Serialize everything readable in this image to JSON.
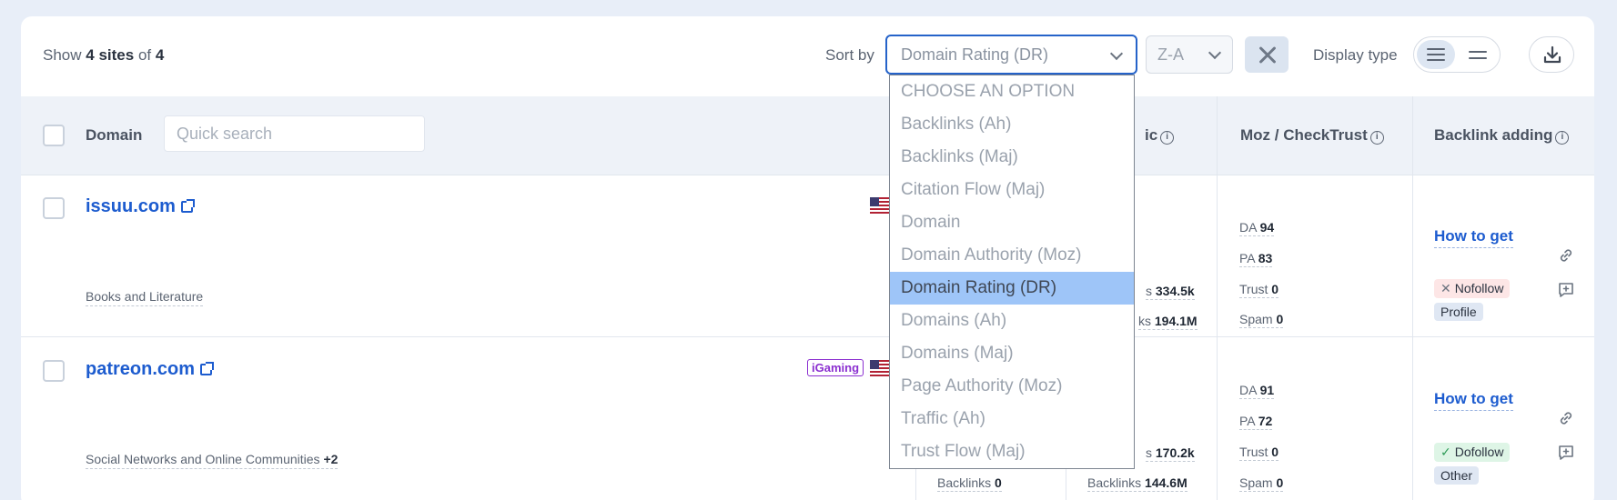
{
  "toolbar": {
    "show_prefix": "Show",
    "show_count": "4 sites",
    "show_mid": "of",
    "show_total": "4",
    "sort_by_label": "Sort by",
    "sort_value": "Domain Rating (DR)",
    "order_value": "Z-A",
    "display_type_label": "Display type"
  },
  "table": {
    "headers": {
      "domain": "Domain",
      "quick_search_placeholder": "Quick search",
      "traffic_partial": "ic",
      "moz": "Moz / CheckTrust",
      "backlink_adding": "Backlink adding",
      "info_glyph": "i"
    },
    "rows": [
      {
        "domain": "issuu.com",
        "category": "Books and Literature",
        "category_more": "",
        "badge": "",
        "traffic_label_a": "s",
        "traffic_value_a": "334.5k",
        "traffic_label_b": "ks",
        "traffic_value_b": "194.1M",
        "da_label": "DA",
        "da": "94",
        "pa_label": "PA",
        "pa": "83",
        "trust_label": "Trust",
        "trust": "0",
        "spam_label": "Spam",
        "spam": "0",
        "how_to": "How to get",
        "follow_mark": "✕",
        "follow": "Nofollow",
        "link_type": "Profile"
      },
      {
        "domain": "patreon.com",
        "category": "Social Networks and Online Communities",
        "category_more": "+2",
        "badge": "iGaming",
        "partial_backlinks_label": "Backlinks",
        "partial_backlinks_value": "0",
        "traffic_label_a": "s",
        "traffic_value_a": "170.2k",
        "traffic_label_b": "Backlinks",
        "traffic_value_b": "144.6M",
        "da_label": "DA",
        "da": "91",
        "pa_label": "PA",
        "pa": "72",
        "trust_label": "Trust",
        "trust": "0",
        "spam_label": "Spam",
        "spam": "0",
        "how_to": "How to get",
        "follow_mark": "✓",
        "follow": "Dofollow",
        "link_type": "Other"
      }
    ]
  },
  "sort_dropdown": {
    "options": [
      "CHOOSE AN OPTION",
      "Backlinks (Ah)",
      "Backlinks (Maj)",
      "Citation Flow (Maj)",
      "Domain",
      "Domain Authority (Moz)",
      "Domain Rating (DR)",
      "Domains (Ah)",
      "Domains (Maj)",
      "Page Authority (Moz)",
      "Traffic (Ah)",
      "Trust Flow (Maj)"
    ],
    "selected_index": 6
  },
  "colors": {
    "accent": "#1d5ccf",
    "selected_option": "#9ec5f8",
    "page_bg": "#e8eef8",
    "header_bg": "#eef2f8"
  }
}
